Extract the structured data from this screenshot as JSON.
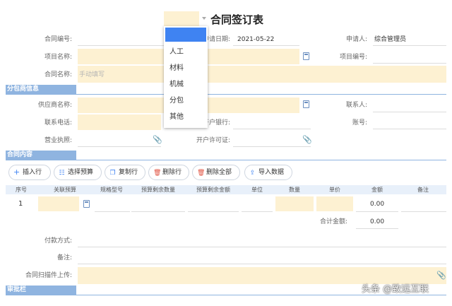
{
  "header": {
    "title": "合同签订表"
  },
  "form": {
    "contract_no_label": "合同编号:",
    "apply_date_label": "申请日期:",
    "apply_date_value": "2021-05-22",
    "applicant_label": "申请人:",
    "applicant_value": "综合管理员",
    "project_name_label": "项目名称:",
    "project_no_label": "项目编号:",
    "contract_name_label": "合同名称:",
    "contract_name_placeholder": "手动填写"
  },
  "sections": {
    "subcontractor": "分包商信息",
    "contract_content": "合同内容",
    "approval": "审批栏"
  },
  "subcontractor": {
    "supplier_name_label": "供应商名称:",
    "contact_label": "联系人:",
    "phone_label": "联系电话:",
    "bank_label": "开户银行:",
    "account_label": "账号:",
    "license_label": "营业执照:",
    "permit_label": "开户许可证:"
  },
  "toolbar": {
    "insert_row": "插入行",
    "select_budget": "选择预算",
    "copy_row": "复制行",
    "delete_row": "删除行",
    "delete_all": "删除全部",
    "import_data": "导入数据"
  },
  "table": {
    "headers": [
      "序号",
      "关联预算",
      "规格型号",
      "预算剩余数量",
      "预算剩余金额",
      "单位",
      "数量",
      "单价",
      "金额",
      "备注"
    ],
    "rows": [
      {
        "index": "1",
        "amount": "0.00"
      }
    ],
    "total_label": "合计金额:",
    "total_value": "0.00"
  },
  "bottom": {
    "payment_label": "付款方式:",
    "remark_label": "备注:",
    "upload_label": "合同扫描件上传:"
  },
  "dropdown": {
    "options": [
      "人工",
      "材料",
      "机械",
      "分包",
      "其他"
    ]
  },
  "watermark": {
    "text": "头条 @致远互联"
  },
  "colors": {
    "accent": "#8fb4e0",
    "field": "#fdf1d2",
    "selected": "#3f83f2"
  }
}
